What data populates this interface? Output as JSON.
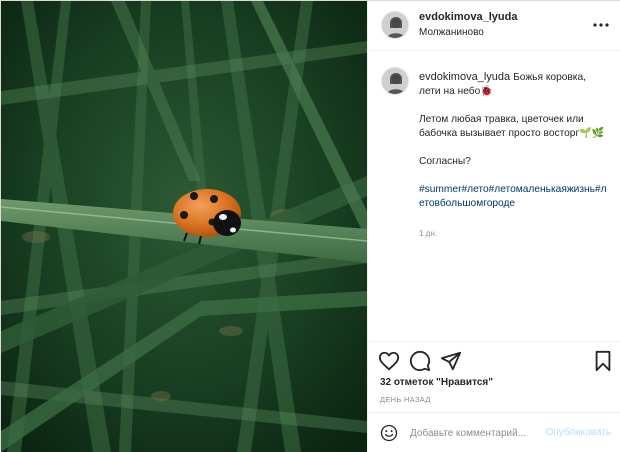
{
  "header": {
    "username": "evdokimova_lyuda",
    "location": "Молжаниново"
  },
  "caption": {
    "username": "evdokimova_lyuda",
    "line1": "Божья коровка, лети на небо🐞",
    "line2": "Летом любая травка, цветочек или бабочка вызывает просто восторг🌱🌿",
    "line3": "Согласны?",
    "hashtags": "#summer#лето#летомаленькаяжизнь#летовбольшомгороде",
    "time_ago": "1 дн."
  },
  "actions": {
    "likes": "32 отметок \"Нравится\"",
    "date": "ДЕНЬ НАЗАД"
  },
  "comment": {
    "placeholder": "Добавьте комментарий...",
    "publish_label": "Опубликовать"
  },
  "colors": {
    "link": "#00376b",
    "publish_disabled": "#b2dffc",
    "secondary_text": "#8e8e8e"
  },
  "icons": [
    "more-options-icon",
    "heart-icon",
    "comment-icon",
    "share-icon",
    "bookmark-icon",
    "emoji-icon"
  ]
}
